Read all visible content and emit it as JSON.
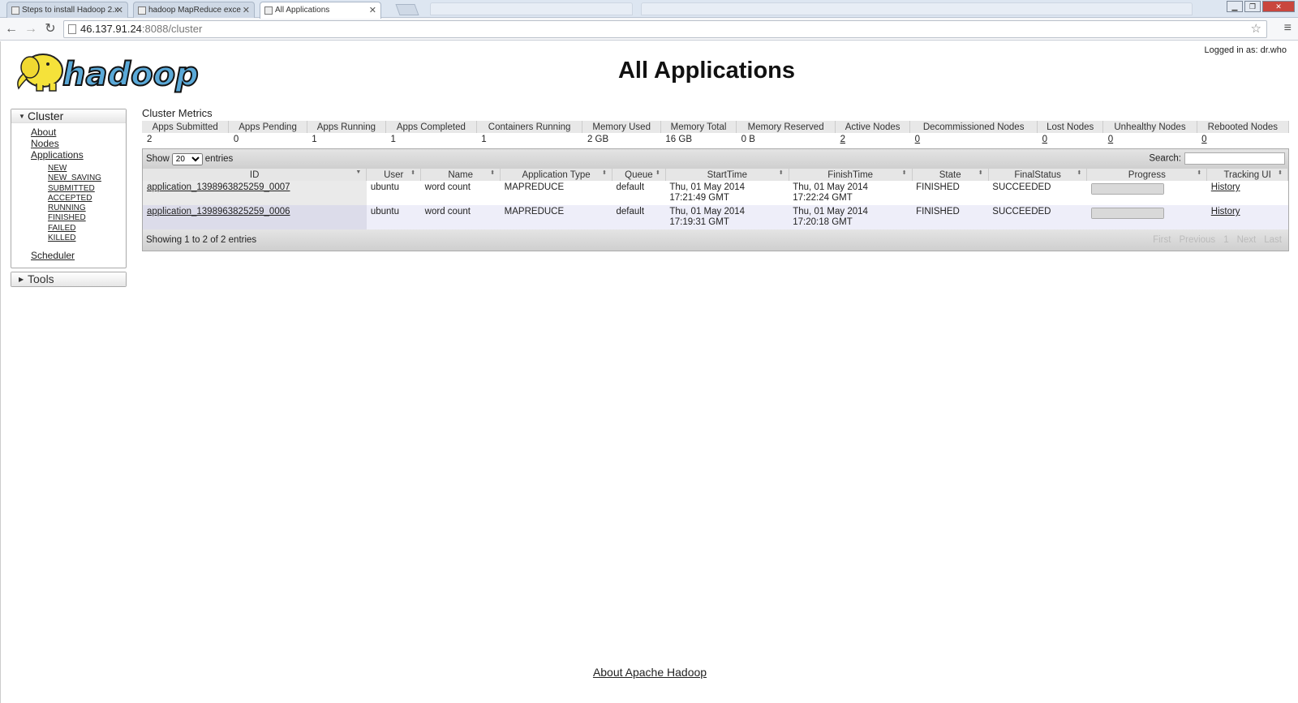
{
  "browser": {
    "tabs": [
      {
        "title": "Steps to install Hadoop 2.x"
      },
      {
        "title": "hadoop MapReduce exce"
      },
      {
        "title": "All Applications"
      }
    ],
    "url_host": "46.137.91.24",
    "url_path": ":8088/cluster"
  },
  "header": {
    "title": "All Applications",
    "logged_in": "Logged in as: dr.who",
    "logo_text": "hadoop"
  },
  "nav": {
    "cluster_label": "Cluster",
    "cluster_items": [
      "About",
      "Nodes",
      "Applications"
    ],
    "app_states": [
      "NEW",
      "NEW_SAVING",
      "SUBMITTED",
      "ACCEPTED",
      "RUNNING",
      "FINISHED",
      "FAILED",
      "KILLED"
    ],
    "scheduler": "Scheduler",
    "tools_label": "Tools"
  },
  "metrics": {
    "title": "Cluster Metrics",
    "headers": [
      "Apps Submitted",
      "Apps Pending",
      "Apps Running",
      "Apps Completed",
      "Containers Running",
      "Memory Used",
      "Memory Total",
      "Memory Reserved",
      "Active Nodes",
      "Decommissioned Nodes",
      "Lost Nodes",
      "Unhealthy Nodes",
      "Rebooted Nodes"
    ],
    "values": [
      "2",
      "0",
      "1",
      "1",
      "1",
      "2 GB",
      "16 GB",
      "0 B",
      "2",
      "0",
      "0",
      "0",
      "0"
    ]
  },
  "table": {
    "show_label": "Show",
    "entries_label": "entries",
    "page_size": "20",
    "search_label": "Search:",
    "search_value": "",
    "columns": [
      "ID",
      "User",
      "Name",
      "Application Type",
      "Queue",
      "StartTime",
      "FinishTime",
      "State",
      "FinalStatus",
      "Progress",
      "Tracking UI"
    ],
    "rows": [
      {
        "id": "application_1398963825259_0007",
        "user": "ubuntu",
        "name": "word count",
        "type": "MAPREDUCE",
        "queue": "default",
        "start_date": "Thu, 01 May 2014",
        "start_time": "17:21:49 GMT",
        "finish_date": "Thu, 01 May 2014",
        "finish_time": "17:22:24 GMT",
        "state": "FINISHED",
        "final_status": "SUCCEEDED",
        "progress": 100,
        "tracking": "History"
      },
      {
        "id": "application_1398963825259_0006",
        "user": "ubuntu",
        "name": "word count",
        "type": "MAPREDUCE",
        "queue": "default",
        "start_date": "Thu, 01 May 2014",
        "start_time": "17:19:31 GMT",
        "finish_date": "Thu, 01 May 2014",
        "finish_time": "17:20:18 GMT",
        "state": "FINISHED",
        "final_status": "SUCCEEDED",
        "progress": 100,
        "tracking": "History"
      }
    ],
    "info": "Showing 1 to 2 of 2 entries",
    "paging": [
      "First",
      "Previous",
      "1",
      "Next",
      "Last"
    ]
  },
  "footer": {
    "link": "About Apache Hadoop"
  },
  "icons": {
    "back": "arrow-left-icon",
    "forward": "arrow-right-icon",
    "reload": "reload-icon",
    "star": "star-icon",
    "menu": "menu-icon",
    "logo": "hadoop-elephant-logo"
  },
  "colors": {
    "logo_yellow": "#f5e23a",
    "logo_blue": "#5aa9d8",
    "even_row": "#eeeef9"
  }
}
